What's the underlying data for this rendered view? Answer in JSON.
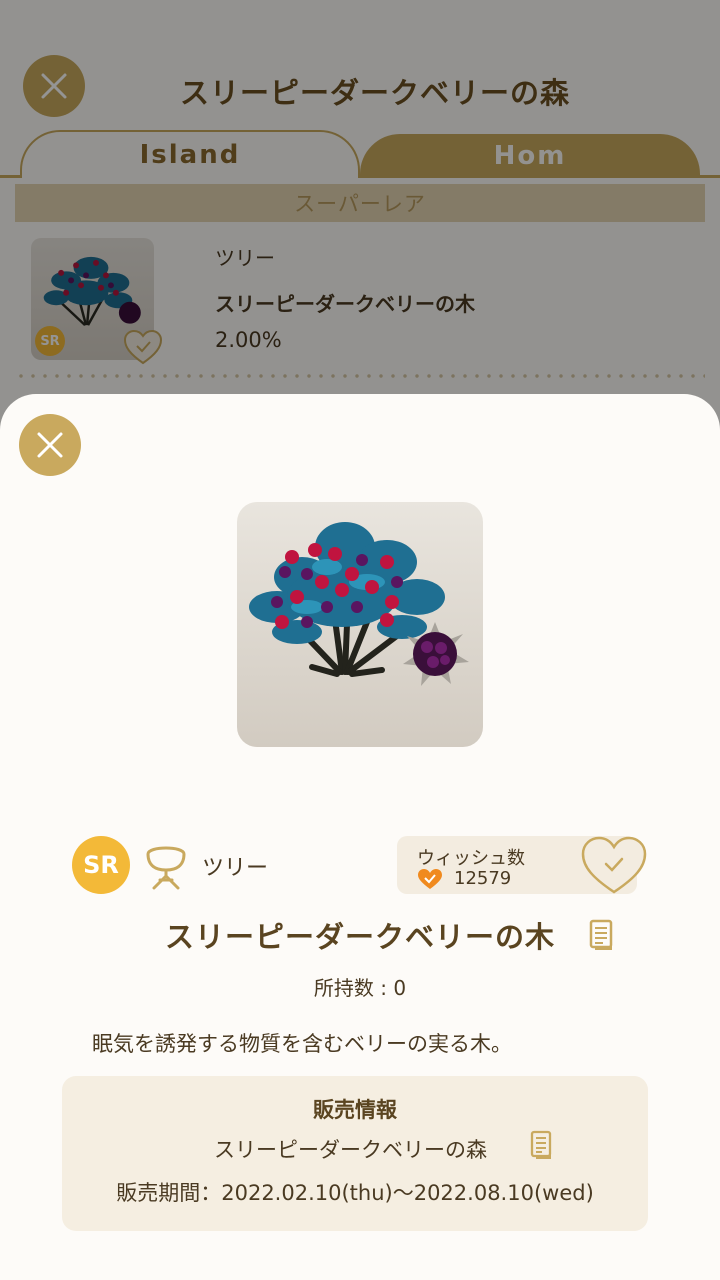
{
  "background": {
    "title": "スリーピーダークベリーの森",
    "tabs": [
      {
        "label": "Island"
      },
      {
        "label": "Hom"
      }
    ],
    "rarity_header": "スーパーレア",
    "list_item": {
      "badge": "SR",
      "category": "ツリー",
      "name": "スリーピーダークベリーの木",
      "rate": "2.00%"
    }
  },
  "modal": {
    "badge": "SR",
    "category": "ツリー",
    "wish": {
      "label": "ウィッシュ数",
      "count": "12579"
    },
    "item_name": "スリーピーダークベリーの木",
    "owned": "所持数 : 0",
    "description": "眠気を誘発する物質を含むベリーの実る木。",
    "sale": {
      "title": "販売情報",
      "shop": "スリーピーダークベリーの森",
      "period": "販売期間：2022.02.10(thu)〜2022.08.10(wed)"
    }
  },
  "colors": {
    "accent_gold": "#c9a95e",
    "badge_sr": "#f3b938",
    "text_brown": "#5a4420",
    "wish_heart": "#f08a1e"
  },
  "icons": [
    "close-icon",
    "tree-category-icon",
    "heart-check-icon",
    "document-icon"
  ]
}
